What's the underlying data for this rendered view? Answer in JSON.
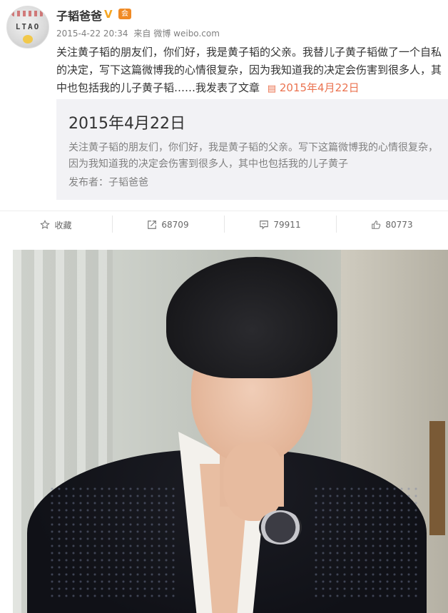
{
  "post": {
    "author": {
      "name": "子韬爸爸",
      "verified_badge": "V",
      "member_badge": "会",
      "avatar_text": "LTAO"
    },
    "meta": {
      "time": "2015-4-22 20:34",
      "source_prefix": "来自",
      "source": "微博 weibo.com"
    },
    "text": "关注黄子韬的朋友们，你们好，我是黄子韬的父亲。我替儿子黄子韬做了一个自私的决定，写下这篇微博我的心情很复杂，因为我知道我的决定会伤害到很多人，其中也包括我的儿子黄子韬……我发表了文章",
    "article_link": "2015年4月22日",
    "article_card": {
      "title": "2015年4月22日",
      "summary": "关注黄子韬的朋友们，你们好，我是黄子韬的父亲。写下这篇微博我的心情很复杂，因为我知道我的决定会伤害到很多人，其中也包括我的儿子黄子",
      "author_label": "发布者：",
      "author": "子韬爸爸"
    },
    "actions": {
      "favorite": "收藏",
      "repost": "68709",
      "comment": "79911",
      "like": "80773"
    },
    "colors": {
      "link": "#eb7350",
      "verified": "#f5a623",
      "card_bg": "#f2f2f5",
      "muted": "#808080"
    }
  }
}
